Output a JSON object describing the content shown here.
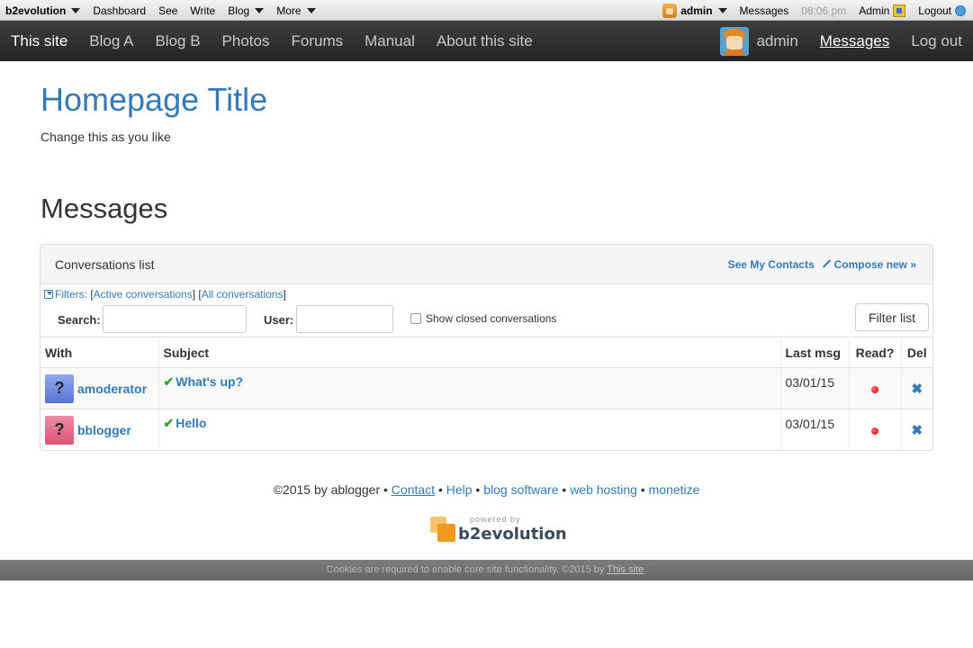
{
  "evobar": {
    "brand": "b2evolution",
    "menu": [
      "Dashboard",
      "See",
      "Write",
      "Blog",
      "More"
    ],
    "user": "admin",
    "messages": "Messages",
    "time": "08:06 pm",
    "admin": "Admin",
    "logout": "Logout"
  },
  "nav": {
    "items": [
      "This site",
      "Blog A",
      "Blog B",
      "Photos",
      "Forums",
      "Manual",
      "About this site"
    ],
    "user": "admin",
    "messages": "Messages",
    "logout": "Log out"
  },
  "page": {
    "title": "Homepage Title",
    "subtitle": "Change this as you like",
    "section_title": "Messages"
  },
  "panel": {
    "title": "Conversations list",
    "see_contacts": "See My Contacts",
    "compose": "Compose new »",
    "filters_label": "Filters:",
    "filter_active": "Active conversations",
    "filter_all": "All conversations",
    "search_label": "Search:",
    "search_value": "",
    "user_label": "User:",
    "user_value": "",
    "show_closed": "Show closed conversations",
    "filter_button": "Filter list",
    "columns": [
      "With",
      "Subject",
      "Last msg",
      "Read?",
      "Del"
    ],
    "rows": [
      {
        "with": "amoderator",
        "avatar_glyph": "?",
        "subject": "What's up?",
        "last_msg": "03/01/15"
      },
      {
        "with": "bblogger",
        "avatar_glyph": "?",
        "subject": "Hello",
        "last_msg": "03/01/15"
      }
    ]
  },
  "footer": {
    "copyright": "©2015 by ablogger •",
    "contact": "Contact",
    "sep": "•",
    "help": "Help",
    "blog_software": "blog software",
    "web_hosting": "web hosting",
    "monetize": "monetize",
    "powered_small": "powered by",
    "powered_big": "b2evolution"
  },
  "cookie": {
    "text": "Cookies are required to enable core site functionality. ©2015 by",
    "link": "This site",
    "end": "."
  },
  "colors": {
    "link": "#337ab7",
    "nav_bg": "#2f2f2f",
    "unread_dot": "#d10000",
    "check": "#2aa52a"
  }
}
